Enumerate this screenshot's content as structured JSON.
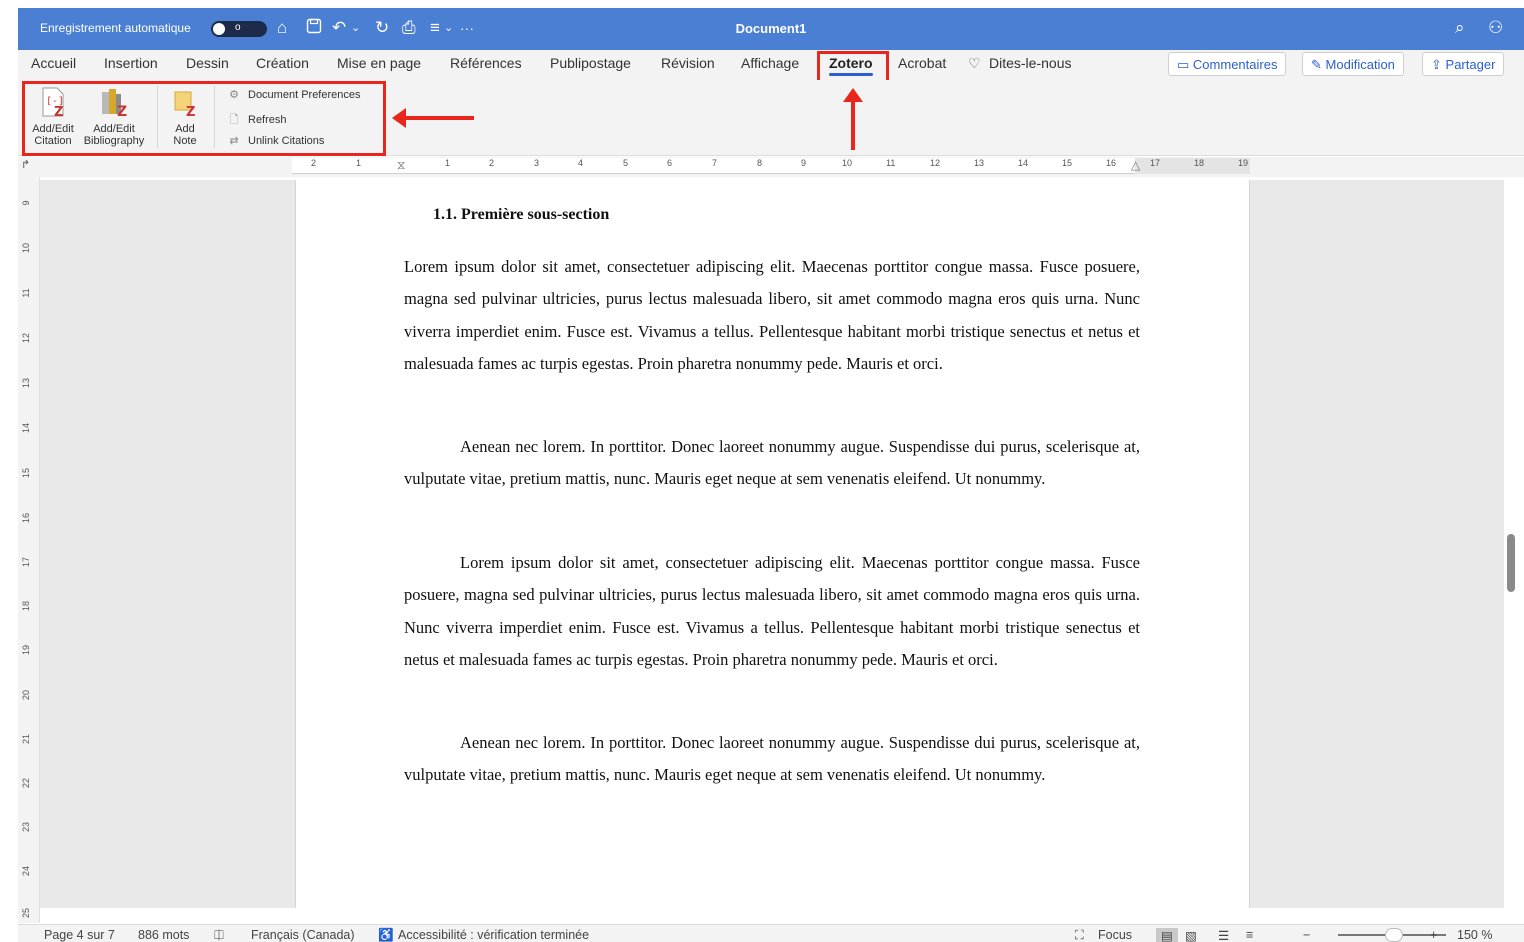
{
  "titlebar": {
    "autosave_label": "Enregistrement automatique",
    "toggle_state": "o",
    "document_title": "Document1",
    "icons": [
      "home-icon",
      "save-icon",
      "undo-icon",
      "redo-icon",
      "print-icon",
      "customize-icon",
      "more-icon",
      "search-icon",
      "share-people-icon"
    ]
  },
  "tabs": [
    "Accueil",
    "Insertion",
    "Dessin",
    "Création",
    "Mise en page",
    "Références",
    "Publipostage",
    "Révision",
    "Affichage",
    "Zotero",
    "Acrobat",
    "Dites-le-nous"
  ],
  "active_tab": "Zotero",
  "right_buttons": {
    "comments": "Commentaires",
    "editing": "Modification",
    "share": "Partager"
  },
  "ribbon": {
    "add_edit_citation": [
      "Add/Edit",
      "Citation"
    ],
    "add_edit_bibliography": [
      "Add/Edit",
      "Bibliography"
    ],
    "add_note": [
      "Add",
      "Note"
    ],
    "document_preferences": "Document Preferences",
    "refresh": "Refresh",
    "unlink_citations": "Unlink Citations"
  },
  "ruler": {
    "numbers": [
      "2",
      "1",
      "1",
      "2",
      "3",
      "4",
      "5",
      "6",
      "7",
      "8",
      "9",
      "10",
      "11",
      "12",
      "13",
      "14",
      "15",
      "16",
      "17",
      "18",
      "19"
    ],
    "vertical_numbers": [
      "9",
      "10",
      "11",
      "12",
      "13",
      "14",
      "15",
      "16",
      "17",
      "18",
      "19",
      "20",
      "21",
      "22",
      "23",
      "24",
      "25"
    ]
  },
  "document": {
    "heading": "1.1. Première sous-section",
    "paragraphs": [
      "Lorem ipsum dolor sit amet, consectetuer adipiscing elit. Maecenas porttitor congue massa. Fusce posuere, magna sed pulvinar ultricies, purus lectus malesuada libero, sit amet commodo magna eros quis urna. Nunc viverra imperdiet enim. Fusce est. Vivamus a tellus. Pellentesque habitant morbi tristique senectus et netus et malesuada fames ac turpis egestas. Proin pharetra nonummy pede. Mauris et orci.",
      "Aenean nec lorem. In porttitor. Donec laoreet nonummy augue. Suspendisse dui purus, scelerisque at, vulputate vitae, pretium mattis, nunc. Mauris eget neque at sem venenatis eleifend. Ut nonummy.",
      "Lorem ipsum dolor sit amet, consectetuer adipiscing elit. Maecenas porttitor congue massa. Fusce posuere, magna sed pulvinar ultricies, purus lectus malesuada libero, sit amet commodo magna eros quis urna. Nunc viverra imperdiet enim. Fusce est. Vivamus a tellus. Pellentesque habitant morbi tristique senectus et netus et malesuada fames ac turpis egestas. Proin pharetra nonummy pede. Mauris et orci.",
      "Aenean nec lorem. In porttitor. Donec laoreet nonummy augue. Suspendisse dui purus, scelerisque at, vulputate vitae, pretium mattis, nunc. Mauris eget neque at sem venenatis eleifend. Ut nonummy."
    ]
  },
  "statusbar": {
    "page": "Page 4 sur 7",
    "words": "886 mots",
    "language": "Français (Canada)",
    "accessibility": "Accessibilité : vérification terminée",
    "focus": "Focus",
    "zoom": "150 %"
  },
  "colors": {
    "titlebar": "#4a7fd4",
    "highlight": "#e8261b",
    "accent": "#2b5fcf"
  }
}
